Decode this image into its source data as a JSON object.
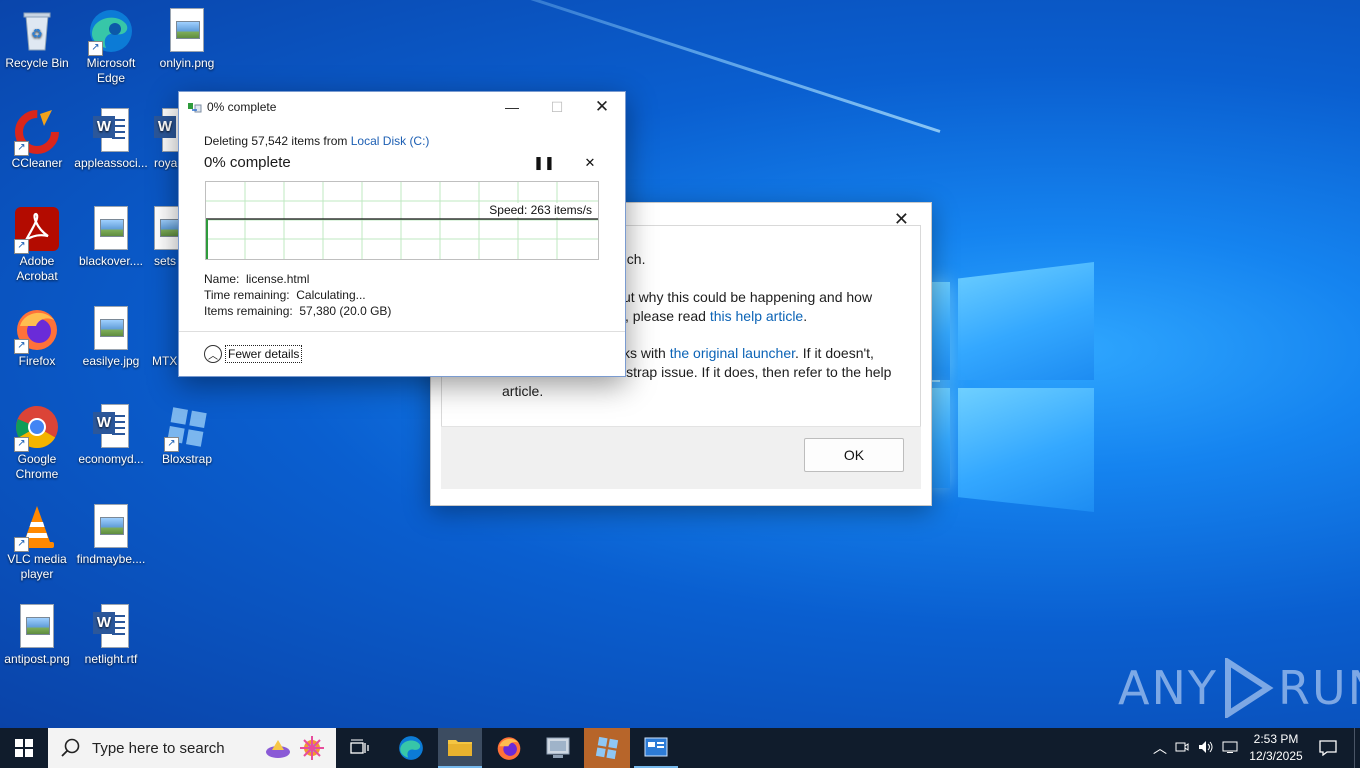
{
  "desktop": {
    "icons": [
      {
        "label": "Recycle Bin",
        "icon": "recycle-bin-icon"
      },
      {
        "label": "Microsoft Edge",
        "icon": "edge-icon"
      },
      {
        "label": "onlyin.png",
        "icon": "image-file-icon"
      },
      {
        "label": "CCleaner",
        "icon": "ccleaner-icon"
      },
      {
        "label": "appleassoci...",
        "icon": "word-doc-icon"
      },
      {
        "label": "roya",
        "icon": "word-doc-icon"
      },
      {
        "label": "Adobe Acrobat",
        "icon": "acrobat-icon"
      },
      {
        "label": "blackover....",
        "icon": "image-file-icon"
      },
      {
        "label": "sets",
        "icon": "image-file-icon"
      },
      {
        "label": "Firefox",
        "icon": "firefox-icon"
      },
      {
        "label": "easilye.jpg",
        "icon": "image-file-icon"
      },
      {
        "label": "MTX",
        "icon": "image-file-icon"
      },
      {
        "label": "Google Chrome",
        "icon": "chrome-icon"
      },
      {
        "label": "economyd...",
        "icon": "word-doc-icon"
      },
      {
        "label": "Bloxstrap",
        "icon": "bloxstrap-icon"
      },
      {
        "label": "VLC media player",
        "icon": "vlc-icon"
      },
      {
        "label": "findmaybe....",
        "icon": "image-file-icon"
      },
      {
        "label": "antipost.png",
        "icon": "image-file-icon"
      },
      {
        "label": "netlight.rtf",
        "icon": "word-doc-icon"
      }
    ]
  },
  "bloxstrap_dialog": {
    "line1": "nch.",
    "line2": "ut why this could be happening and how",
    "line3_pre": ", please read ",
    "line3_link": "this help article",
    "line3_post": ".",
    "line4_pre": "ks with ",
    "line4_link": "the original launcher",
    "line4_post": ". If it doesn't,",
    "line5": "strap issue. If it does, then refer to the help",
    "line6": "article.",
    "ok_label": "OK"
  },
  "progress_window": {
    "title": "0% complete",
    "deleting_prefix": "Deleting 57,542 items from ",
    "deleting_location": "Local Disk (C:)",
    "heading": "0% complete",
    "speed": "Speed: 263 items/s",
    "name_label": "Name:",
    "name_value": "license.html",
    "time_label": "Time remaining:",
    "time_value": "Calculating...",
    "items_label": "Items remaining:",
    "items_value": "57,380 (20.0 GB)",
    "fewer_details": "Fewer details",
    "progress_fraction": 0.0
  },
  "watermark": {
    "text": "ANY",
    "text2": "RUN"
  },
  "taskbar": {
    "search_placeholder": "Type here to search",
    "time": "2:53 PM",
    "date": "12/3/2025"
  },
  "colors": {
    "accent": "#0078d7",
    "link": "#1d5fb3",
    "graph_grid": "#b6e6b6"
  }
}
